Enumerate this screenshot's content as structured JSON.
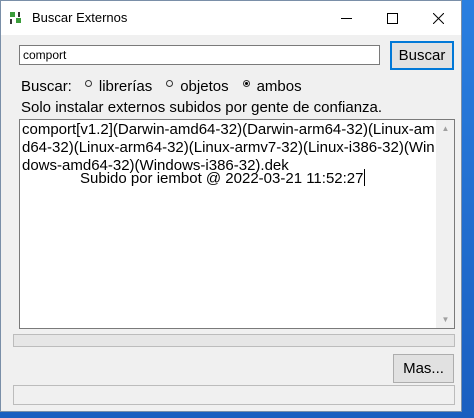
{
  "window": {
    "title": "Buscar Externos"
  },
  "search": {
    "value": "comport",
    "button_label": "Buscar"
  },
  "filter": {
    "label": "Buscar:",
    "options": [
      {
        "label": "librerías",
        "checked": false
      },
      {
        "label": "objetos",
        "checked": false
      },
      {
        "label": "ambos",
        "checked": true
      }
    ]
  },
  "notice": "Solo instalar externos subidos por gente de confianza.",
  "results": {
    "entry": "comport[v1.2](Darwin-amd64-32)(Darwin-arm64-32)(Linux-amd64-32)(Linux-arm64-32)(Linux-armv7-32)(Linux-i386-32)(Windows-amd64-32)(Windows-i386-32).dek",
    "uploaded_by": "Subido por iembot @ 2022-03-21 11:52:27"
  },
  "progress": 0,
  "more_button_label": "Mas...",
  "colors": {
    "accent": "#0078d7",
    "window_bg": "#f0f0f0",
    "desktop": "#1a5fc0"
  }
}
